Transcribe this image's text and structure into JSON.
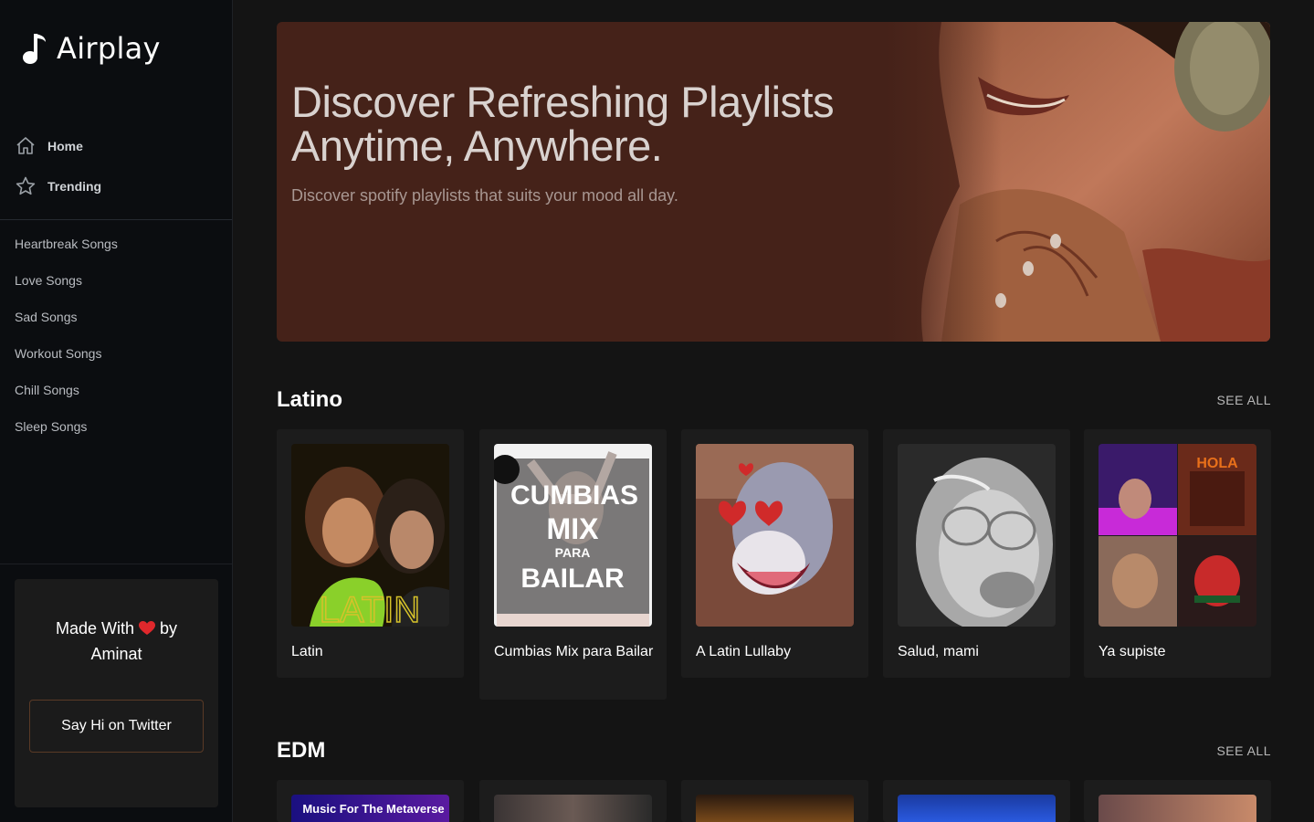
{
  "app": {
    "name": "Airplay"
  },
  "nav": {
    "home": "Home",
    "trending": "Trending"
  },
  "categories": [
    "Heartbreak Songs",
    "Love Songs",
    "Sad Songs",
    "Workout Songs",
    "Chill Songs",
    "Sleep Songs"
  ],
  "credit": {
    "made_with": "Made With",
    "by": "by",
    "author": "Aminat",
    "twitter_button": "Say Hi on Twitter"
  },
  "hero": {
    "title_line1": "Discover Refreshing Playlists",
    "title_line2": "Anytime, Anywhere.",
    "subtitle": "Discover spotify playlists that suits your mood all day."
  },
  "sections": [
    {
      "title": "Latino",
      "see_all": "SEE ALL",
      "playlists": [
        "Latin",
        "Cumbias Mix para Bailar",
        "A Latin Lullaby",
        "Salud, mami",
        "Ya supiste"
      ]
    },
    {
      "title": "EDM",
      "see_all": "SEE ALL"
    }
  ],
  "artwork_text": {
    "latin_cover": "LATIN",
    "cumbias_line1": "CUMBIAS",
    "cumbias_line2": "MIX",
    "cumbias_line3": "PARA",
    "cumbias_line4": "BAILAR",
    "ya_supiste_hola": "HOLA",
    "edm_cover": "Music For The Metaverse"
  },
  "colors": {
    "accent_border": "#5a3a26",
    "hero_bg": "#452219",
    "heart": "#e0282c"
  },
  "icons": {
    "logo": "music-note-icon",
    "home": "home-icon",
    "trending": "star-icon",
    "heart": "heart-icon"
  }
}
